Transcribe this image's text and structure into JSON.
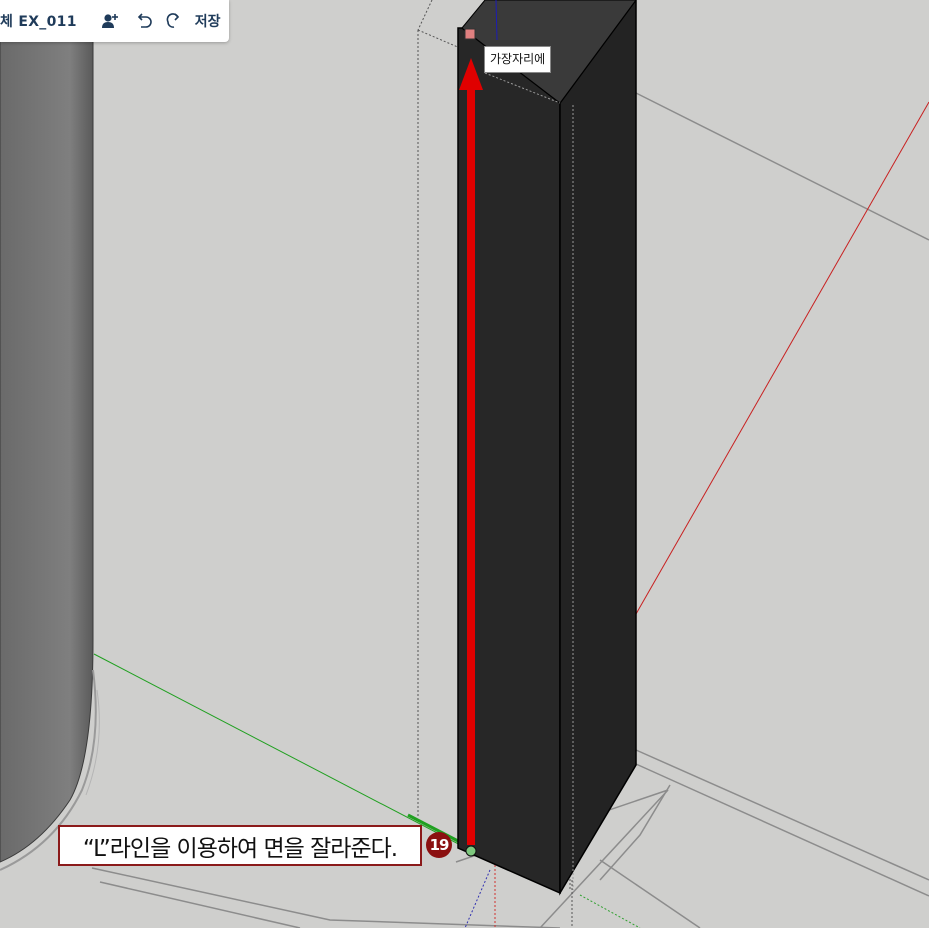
{
  "toolbar": {
    "title": "체 EX_011",
    "save_label": "저장",
    "icons": [
      "add-user-icon",
      "undo-icon",
      "redo-icon"
    ]
  },
  "tooltip": {
    "text": "가장자리에"
  },
  "annotation": {
    "text": "“L”라인을 이용하여 면을 잘라준다.",
    "step_number": "19",
    "border_color": "#8b1a1a"
  },
  "colors": {
    "viewport_bg": "#cfcfcd",
    "column_face": "#272727",
    "arrow": "#e00000",
    "axis_green": "#1aa81a",
    "axis_red": "#c81e1e",
    "axis_blue": "#1c1cb4"
  }
}
